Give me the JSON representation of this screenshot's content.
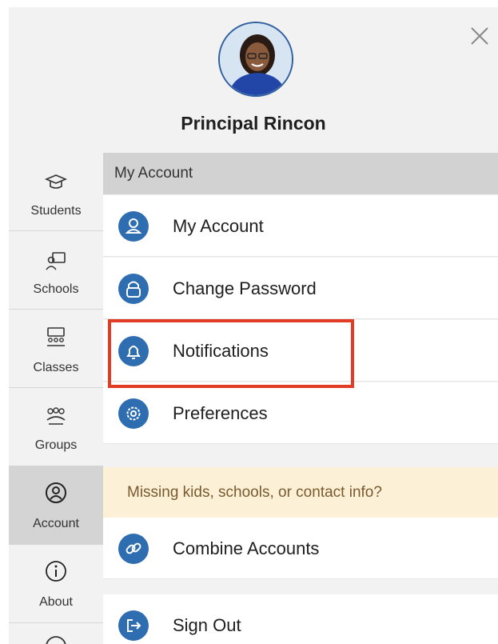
{
  "header": {
    "name": "Principal Rincon"
  },
  "sidebar": {
    "items": [
      {
        "label": "Students",
        "icon": "graduation-cap-icon"
      },
      {
        "label": "Schools",
        "icon": "school-icon"
      },
      {
        "label": "Classes",
        "icon": "classroom-icon"
      },
      {
        "label": "Groups",
        "icon": "group-icon"
      },
      {
        "label": "Account",
        "icon": "account-icon",
        "active": true
      },
      {
        "label": "About",
        "icon": "info-icon"
      }
    ]
  },
  "content": {
    "section_title": "My Account",
    "items": [
      {
        "label": "My Account",
        "icon": "person-icon"
      },
      {
        "label": "Change Password",
        "icon": "lock-icon"
      },
      {
        "label": "Notifications",
        "icon": "bell-icon",
        "highlighted": true
      },
      {
        "label": "Preferences",
        "icon": "gear-icon"
      }
    ],
    "banner": "Missing kids, schools, or contact info?",
    "combine": {
      "label": "Combine Accounts",
      "icon": "link-icon"
    },
    "signout": {
      "label": "Sign Out",
      "icon": "sign-out-icon"
    }
  },
  "colors": {
    "accent": "#2e6db0",
    "highlight": "#e23c24",
    "banner_bg": "#fcf0d6",
    "banner_text": "#7a5a2e"
  }
}
